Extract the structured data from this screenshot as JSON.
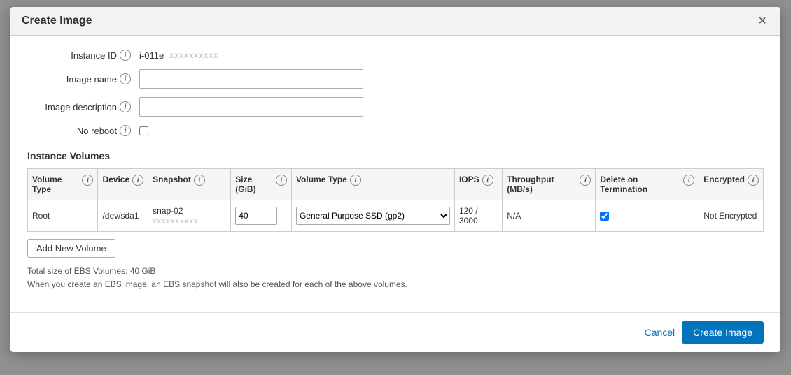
{
  "modal": {
    "title": "Create Image",
    "close_label": "×"
  },
  "form": {
    "instance_id_label": "Instance ID",
    "instance_id_value": "i-011e",
    "instance_id_blurred": "xxxxxxxxxx",
    "image_name_label": "Image name",
    "image_name_placeholder": "",
    "image_description_label": "Image description",
    "image_description_placeholder": "",
    "no_reboot_label": "No reboot"
  },
  "volumes_section": {
    "title": "Instance Volumes",
    "columns": {
      "volume_type": "Volume Type",
      "device": "Device",
      "snapshot": "Snapshot",
      "size_gib": "Size (GiB)",
      "volume_type_col": "Volume Type",
      "iops": "IOPS",
      "throughput": "Throughput (MB/s)",
      "delete_on_termination": "Delete on Termination",
      "encrypted": "Encrypted"
    },
    "rows": [
      {
        "volume_type": "Root",
        "device": "/dev/sda1",
        "snapshot": "snap-02",
        "snapshot_blurred": "xxxxxxxxxx",
        "size": "40",
        "volume_type_value": "General Purpose SSD (gp2)",
        "iops": "120 / 3000",
        "throughput": "N/A",
        "delete_on_termination": true,
        "encrypted": "Not Encrypted"
      }
    ],
    "add_volume_label": "Add New Volume"
  },
  "footer_notes": {
    "total_size": "Total size of EBS Volumes: 40 GiB",
    "ebs_note": "When you create an EBS image, an EBS snapshot will also be created for each of the above volumes."
  },
  "actions": {
    "cancel_label": "Cancel",
    "create_label": "Create Image"
  }
}
